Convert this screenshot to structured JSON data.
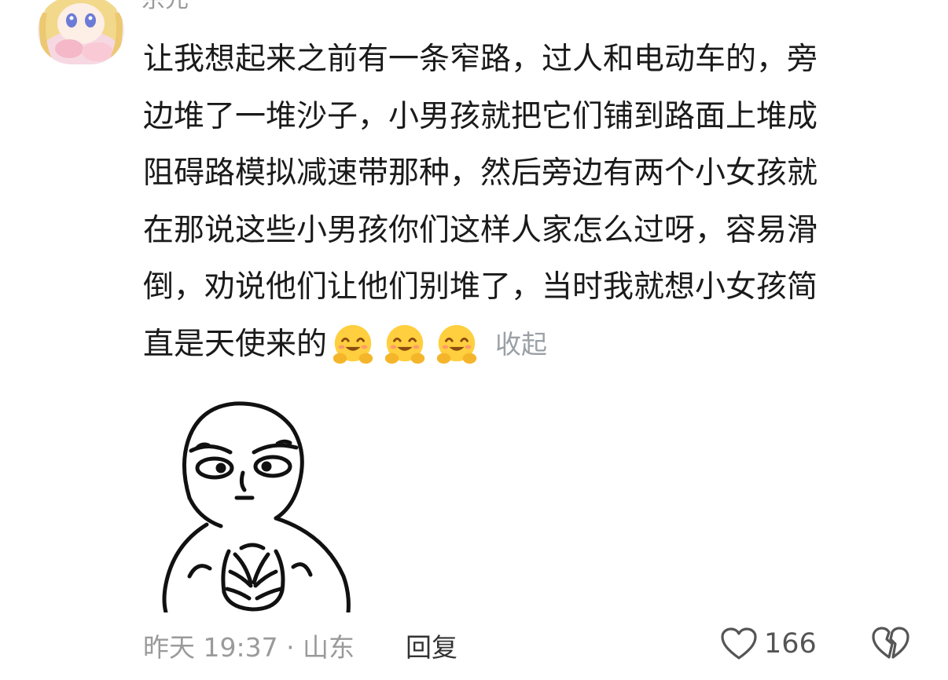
{
  "comment": {
    "username": "宗元",
    "lines": [
      "让我想起来之前有一条窄路，过人和电动车的，旁",
      "边堆了一堆沙子，小男孩就把它们铺到路面上堆成",
      "阻碍路模拟减速带那种，然后旁边有两个小女孩就",
      "在那说这些小男孩你们这样人家怎么过呀，容易滑",
      "倒，劝说他们让他们别堆了，当时我就想小女孩简"
    ],
    "last_line": "直是天使来的",
    "emojis": [
      "hugging-face",
      "hugging-face",
      "hugging-face"
    ],
    "collapse_label": "收起"
  },
  "footer": {
    "meta": "昨天 19:37 · 山东",
    "reply_label": "回复",
    "like_count": "166"
  },
  "icons": {
    "like": "heart-outline-icon",
    "dislike": "broken-heart-icon"
  }
}
